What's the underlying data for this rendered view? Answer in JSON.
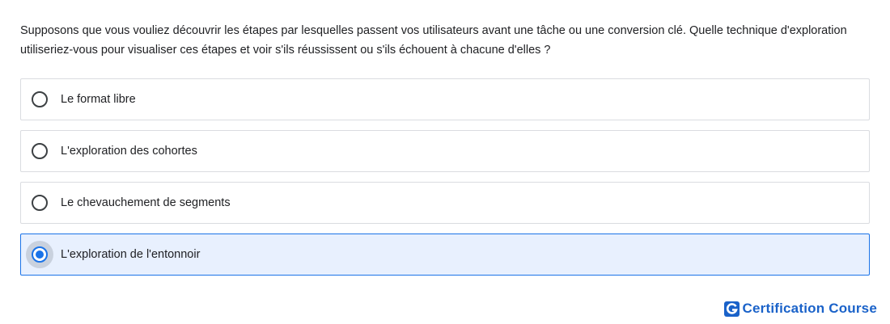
{
  "question": {
    "text": "Supposons que vous vouliez découvrir les étapes par lesquelles passent vos utilisateurs avant une tâche ou une conversion clé. Quelle technique d'exploration utiliseriez-vous pour visualiser ces étapes et voir s'ils réussissent ou s'ils échouent à chacune d'elles ?"
  },
  "options": [
    {
      "label": "Le format libre",
      "selected": false
    },
    {
      "label": "L'exploration des cohortes",
      "selected": false
    },
    {
      "label": "Le chevauchement de segments",
      "selected": false
    },
    {
      "label": "L'exploration de l'entonnoir",
      "selected": true
    }
  ],
  "brand": {
    "logo_letter": "G",
    "text": "Certification Course",
    "color": "#1a62c9"
  },
  "colors": {
    "accent": "#1a73e8",
    "selected_bg": "#e8f0fe",
    "border": "#dadce0"
  },
  "icons": {
    "radio_unchecked": "radio-unchecked-icon",
    "radio_checked": "radio-checked-icon",
    "brand_logo": "g-logo-icon"
  }
}
